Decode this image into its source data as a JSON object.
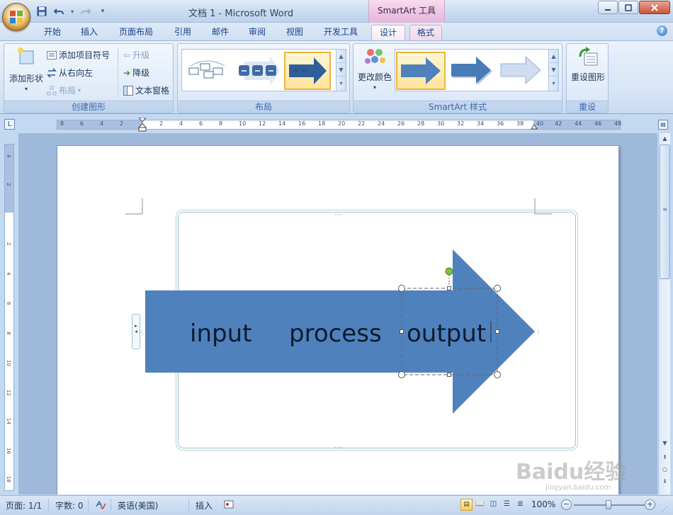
{
  "window": {
    "title": "文档 1 - Microsoft Word",
    "context_title": "SmartArt 工具"
  },
  "tabs": [
    {
      "label": "开始"
    },
    {
      "label": "插入"
    },
    {
      "label": "页面布局"
    },
    {
      "label": "引用"
    },
    {
      "label": "邮件"
    },
    {
      "label": "审阅"
    },
    {
      "label": "视图"
    },
    {
      "label": "开发工具"
    },
    {
      "label": "设计"
    },
    {
      "label": "格式"
    }
  ],
  "ribbon": {
    "create_graphic": {
      "label": "创建图形",
      "add_shape": "添加形状",
      "add_bullet": "添加项目符号",
      "right_to_left": "从右向左",
      "layout": "布局",
      "promote": "升级",
      "demote": "降级",
      "text_pane": "文本窗格"
    },
    "layouts": {
      "label": "布局"
    },
    "styles": {
      "label": "SmartArt 样式",
      "change_colors": "更改颜色"
    },
    "reset": {
      "label": "重设",
      "reset_graphic": "重设图形"
    }
  },
  "ruler": {
    "h_ticks": [
      "8",
      "6",
      "4",
      "2",
      "2",
      "4",
      "6",
      "8",
      "10",
      "12",
      "14",
      "16",
      "18",
      "20",
      "22",
      "24",
      "26",
      "28",
      "30",
      "32",
      "34",
      "36",
      "38",
      "40",
      "42",
      "44",
      "46",
      "48"
    ],
    "v_ticks": [
      "4",
      "2",
      "2",
      "4",
      "6",
      "8",
      "10",
      "12",
      "14",
      "16",
      "18"
    ]
  },
  "smartart": {
    "items": [
      "input",
      "process",
      "output"
    ],
    "arrow_color": "#4f81bd"
  },
  "status": {
    "page": "页面: 1/1",
    "words": "字数: 0",
    "language": "英语(美国)",
    "mode": "插入",
    "zoom": "100%"
  },
  "watermark": {
    "brand": "Baidu经验",
    "url": "jingyan.baidu.com"
  }
}
